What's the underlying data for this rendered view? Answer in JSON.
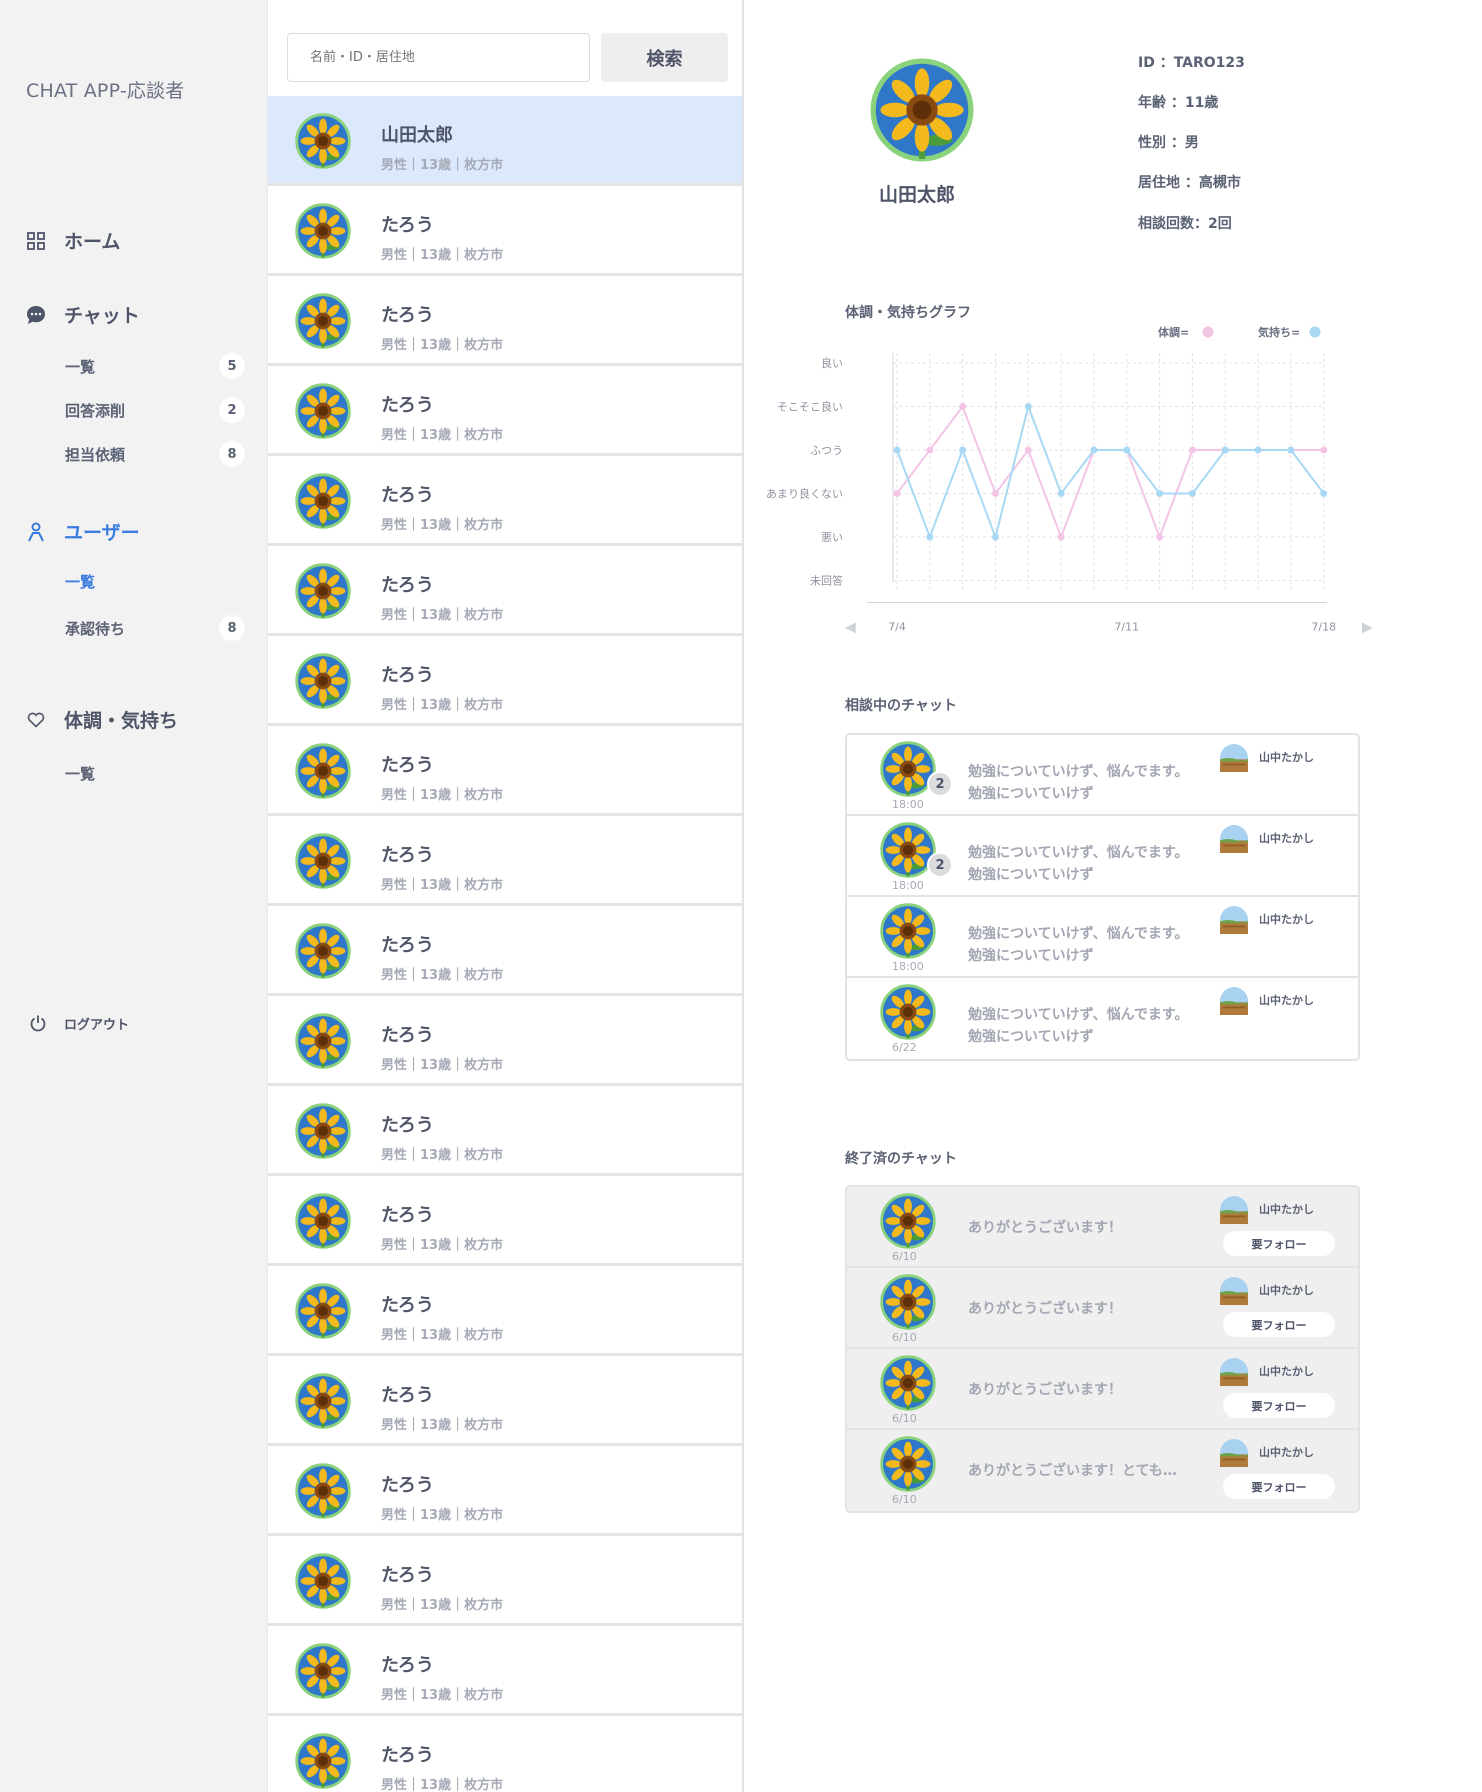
{
  "app": {
    "title": "CHAT APP-応談者"
  },
  "sidebar": {
    "home": {
      "label": "ホーム",
      "icon": "grid-icon"
    },
    "chat": {
      "label": "チャット",
      "icon": "chat-bubble-icon",
      "items": [
        {
          "label": "一覧",
          "badge": "5"
        },
        {
          "label": "回答添削",
          "badge": "2"
        },
        {
          "label": "担当依頼",
          "badge": "8"
        }
      ]
    },
    "user": {
      "label": "ユーザー",
      "icon": "person-icon",
      "items": [
        {
          "label": "一覧",
          "badge": ""
        },
        {
          "label": "承認待ち",
          "badge": "8"
        }
      ]
    },
    "condition": {
      "label": "体調・気持ち",
      "icon": "heart-icon",
      "items": [
        {
          "label": "一覧"
        }
      ]
    },
    "logout": {
      "label": "ログアウト",
      "icon": "power-icon"
    }
  },
  "search": {
    "placeholder": "名前・ID・居住地",
    "button": "検索"
  },
  "users": [
    {
      "name": "山田太郎",
      "meta": "男性｜13歳｜枚方市"
    },
    {
      "name": "たろう",
      "meta": "男性｜13歳｜枚方市"
    },
    {
      "name": "たろう",
      "meta": "男性｜13歳｜枚方市"
    },
    {
      "name": "たろう",
      "meta": "男性｜13歳｜枚方市"
    },
    {
      "name": "たろう",
      "meta": "男性｜13歳｜枚方市"
    },
    {
      "name": "たろう",
      "meta": "男性｜13歳｜枚方市"
    },
    {
      "name": "たろう",
      "meta": "男性｜13歳｜枚方市"
    },
    {
      "name": "たろう",
      "meta": "男性｜13歳｜枚方市"
    },
    {
      "name": "たろう",
      "meta": "男性｜13歳｜枚方市"
    },
    {
      "name": "たろう",
      "meta": "男性｜13歳｜枚方市"
    },
    {
      "name": "たろう",
      "meta": "男性｜13歳｜枚方市"
    },
    {
      "name": "たろう",
      "meta": "男性｜13歳｜枚方市"
    },
    {
      "name": "たろう",
      "meta": "男性｜13歳｜枚方市"
    },
    {
      "name": "たろう",
      "meta": "男性｜13歳｜枚方市"
    },
    {
      "name": "たろう",
      "meta": "男性｜13歳｜枚方市"
    },
    {
      "name": "たろう",
      "meta": "男性｜13歳｜枚方市"
    },
    {
      "name": "たろう",
      "meta": "男性｜13歳｜枚方市"
    },
    {
      "name": "たろう",
      "meta": "男性｜13歳｜枚方市"
    },
    {
      "name": "たろう",
      "meta": "男性｜13歳｜枚方市"
    }
  ],
  "profile": {
    "name": "山田太郎",
    "id": "ID ：TARO123",
    "age": "年齢 ：11歳",
    "gender": "性別 ：男",
    "residence": "居住地 ：高槻市",
    "consult_count": "相談回数：2回"
  },
  "chart_data": {
    "type": "line",
    "title": "体調・気持ちグラフ",
    "categories": [
      "良い",
      "そこそこ良い",
      "ふつう",
      "あまり良くない",
      "悪い",
      "未回答"
    ],
    "x_ticks": [
      "7/4",
      "7/11",
      "7/18"
    ],
    "series": [
      {
        "name": "体調",
        "color": "#f4c4e6",
        "values": [
          2,
          3,
          4,
          2,
          3,
          1,
          3,
          3,
          1,
          3,
          3,
          3,
          3,
          3
        ]
      },
      {
        "name": "気持ち",
        "color": "#a8d8f4",
        "values": [
          3,
          1,
          3,
          1,
          4,
          2,
          3,
          3,
          2,
          2,
          3,
          3,
          3,
          2
        ]
      }
    ],
    "legend": [
      "体調=",
      "気持ち="
    ]
  },
  "active_chats": {
    "title": "相談中のチャット",
    "items": [
      {
        "line1": "勉強についていけず、悩んでます。",
        "line2": "勉強についていけず",
        "time": "18:00",
        "count": "2",
        "supporter": "山中たかし"
      },
      {
        "line1": "勉強についていけず、悩んでます。",
        "line2": "勉強についていけず",
        "time": "18:00",
        "count": "2",
        "supporter": "山中たかし"
      },
      {
        "line1": "勉強についていけず、悩んでます。",
        "line2": "勉強についていけず",
        "time": "18:00",
        "count": "",
        "supporter": "山中たかし"
      },
      {
        "line1": "勉強についていけず、悩んでます。",
        "line2": "勉強についていけず",
        "time": "6/22",
        "count": "",
        "supporter": "山中たかし"
      }
    ]
  },
  "done_chats": {
    "title": "終了済のチャット",
    "items": [
      {
        "message": "ありがとうございます！",
        "time": "6/10",
        "supporter": "山中たかし",
        "follow": "要フォロー"
      },
      {
        "message": "ありがとうございます！",
        "time": "6/10",
        "supporter": "山中たかし",
        "follow": "要フォロー"
      },
      {
        "message": "ありがとうございます！",
        "time": "6/10",
        "supporter": "山中たかし",
        "follow": "要フォロー"
      },
      {
        "message": "ありがとうございます！とても…",
        "time": "6/10",
        "supporter": "山中たかし",
        "follow": "要フォロー"
      }
    ]
  }
}
